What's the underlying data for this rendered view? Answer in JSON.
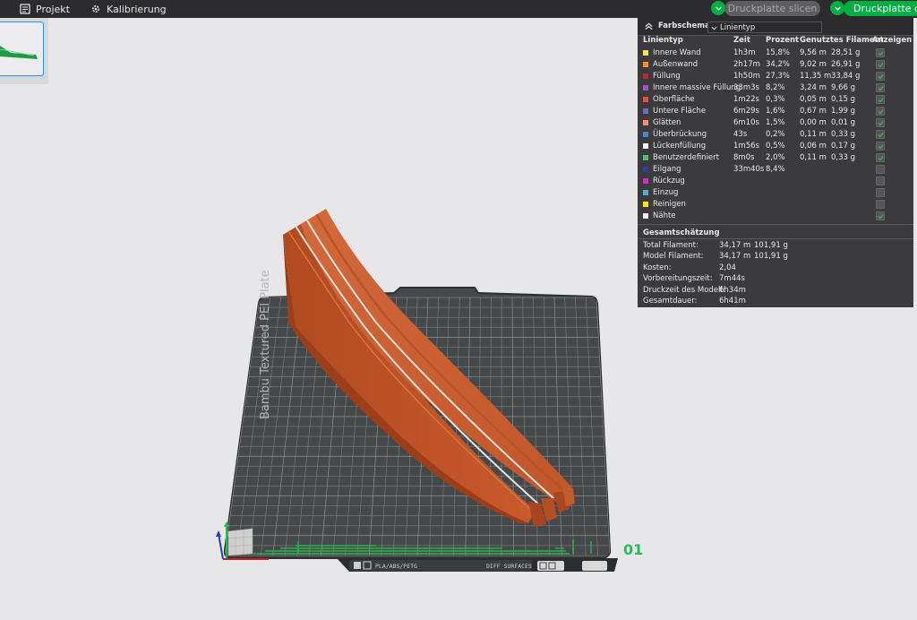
{
  "topbar": {
    "project_label": "Projekt",
    "calibration_label": "Kalibrierung",
    "slice_label": "Druckplatte slicen",
    "print_label": "Druckplatte drucken"
  },
  "plate": {
    "name": "Bambu Textured PEI Plate",
    "number": "01",
    "filament_tag": "PLA/ABS/PETG",
    "surface_tag": "DIFF SURFACES"
  },
  "colors": {
    "accent": "#00ae42",
    "model": "#c4572a",
    "panel_bg": "#3b3b3d"
  },
  "legend": {
    "title": "Farbschema",
    "selected": "Linientyp",
    "headers": {
      "type": "Linientyp",
      "time": "Zeit",
      "percent": "Prozent",
      "used": "Genutztes Filament",
      "show": "Anzeigen"
    },
    "rows": [
      {
        "label": "Innere Wand",
        "color": "#ffe34f",
        "time": "1h3m",
        "percent": "15,8%",
        "len": "9,56 m",
        "weight": "28,51 g",
        "checked": true
      },
      {
        "label": "Außenwand",
        "color": "#ff8d2b",
        "time": "2h17m",
        "percent": "34,2%",
        "len": "9,02 m",
        "weight": "26,91 g",
        "checked": true
      },
      {
        "label": "Füllung",
        "color": "#b62b2b",
        "time": "1h50m",
        "percent": "27,3%",
        "len": "11,35 m",
        "weight": "33,84 g",
        "checked": true
      },
      {
        "label": "Innere massive Füllung",
        "color": "#a54fd1",
        "time": "33m3s",
        "percent": "8,2%",
        "len": "3,24 m",
        "weight": "9,66 g",
        "checked": true
      },
      {
        "label": "Oberfläche",
        "color": "#f04c3c",
        "time": "1m22s",
        "percent": "0,3%",
        "len": "0,05 m",
        "weight": "0,15 g",
        "checked": true
      },
      {
        "label": "Untere Fläche",
        "color": "#7668c9",
        "time": "6m29s",
        "percent": "1,6%",
        "len": "0,67 m",
        "weight": "1,99 g",
        "checked": true
      },
      {
        "label": "Glätten",
        "color": "#ff8d70",
        "time": "6m10s",
        "percent": "1,5%",
        "len": "0,00 m",
        "weight": "0,01 g",
        "checked": true
      },
      {
        "label": "Überbrückung",
        "color": "#4f84c8",
        "time": "43s",
        "percent": "0,2%",
        "len": "0,11 m",
        "weight": "0,33 g",
        "checked": true
      },
      {
        "label": "Lückenfüllung",
        "color": "#ffffff",
        "time": "1m56s",
        "percent": "0,5%",
        "len": "0,06 m",
        "weight": "0,17 g",
        "checked": true
      },
      {
        "label": "Benutzerdefiniert",
        "color": "#4fbf6a",
        "time": "8m0s",
        "percent": "2,0%",
        "len": "0,11 m",
        "weight": "0,33 g",
        "checked": true
      },
      {
        "label": "Eilgang",
        "color": "#2f3f9f",
        "time": "33m40s",
        "percent": "8,4%",
        "len": "",
        "weight": "",
        "checked": false
      },
      {
        "label": "Rückzug",
        "color": "#d629c9",
        "time": "",
        "percent": "",
        "len": "",
        "weight": "",
        "checked": false
      },
      {
        "label": "Einzug",
        "color": "#4fb0d8",
        "time": "",
        "percent": "",
        "len": "",
        "weight": "",
        "checked": false
      },
      {
        "label": "Reinigen",
        "color": "#ffe900",
        "time": "",
        "percent": "",
        "len": "",
        "weight": "",
        "checked": false
      },
      {
        "label": "Nähte",
        "color": "#f2f2f2",
        "time": "",
        "percent": "",
        "len": "",
        "weight": "",
        "checked": true
      }
    ]
  },
  "summary": {
    "title": "Gesamtschätzung",
    "rows": [
      {
        "label": "Total Filament:",
        "v1": "34,17 m",
        "v2": "101,91 g"
      },
      {
        "label": "Model Filament:",
        "v1": "34,17 m",
        "v2": "101,91 g"
      },
      {
        "label": "Kosten:",
        "v1": "2,04",
        "v2": ""
      },
      {
        "label": "Vorbereitungszeit:",
        "v1": "7m44s",
        "v2": ""
      },
      {
        "label": "Druckzeit des Modell:",
        "v1": "6h34m",
        "v2": ""
      },
      {
        "label": "Gesamtdauer:",
        "v1": "6h41m",
        "v2": ""
      }
    ]
  }
}
